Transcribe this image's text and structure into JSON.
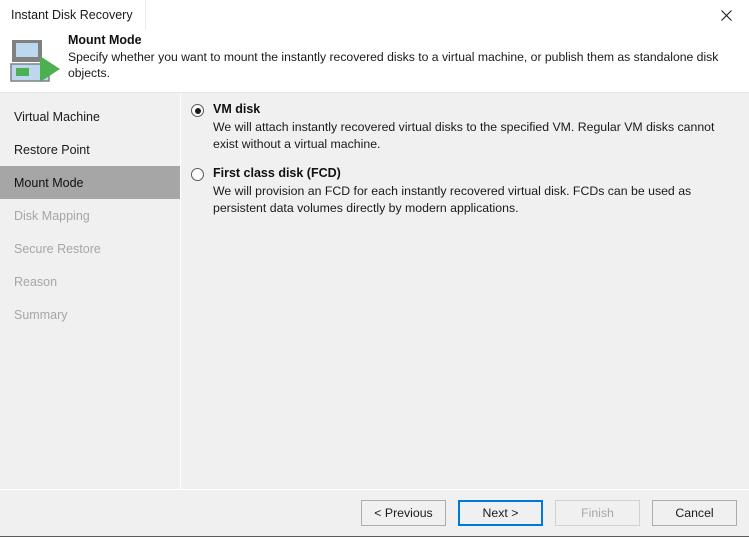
{
  "window": {
    "title": "Instant Disk Recovery",
    "close_icon": "close-icon"
  },
  "header": {
    "icon": "vm-instant-recovery-icon",
    "title": "Mount Mode",
    "description": "Specify whether you want to mount the instantly recovered disks to a virtual machine, or publish them as standalone disk objects."
  },
  "sidebar": {
    "items": [
      {
        "label": "Virtual Machine",
        "state": "done"
      },
      {
        "label": "Restore Point",
        "state": "done"
      },
      {
        "label": "Mount Mode",
        "state": "active"
      },
      {
        "label": "Disk Mapping",
        "state": "upcoming"
      },
      {
        "label": "Secure Restore",
        "state": "upcoming"
      },
      {
        "label": "Reason",
        "state": "upcoming"
      },
      {
        "label": "Summary",
        "state": "upcoming"
      }
    ]
  },
  "content": {
    "options": [
      {
        "label": "VM disk",
        "description": "We will attach instantly recovered virtual disks to the specified VM. Regular VM disks cannot exist without a virtual machine.",
        "selected": true
      },
      {
        "label": "First class disk (FCD)",
        "description": "We will provision an FCD for each instantly recovered virtual disk. FCDs can be used as persistent data volumes directly by modern applications.",
        "selected": false
      }
    ]
  },
  "footer": {
    "buttons": [
      {
        "label": "< Previous",
        "state": "normal"
      },
      {
        "label": "Next >",
        "state": "focused"
      },
      {
        "label": "Finish",
        "state": "disabled"
      },
      {
        "label": "Cancel",
        "state": "normal"
      }
    ]
  },
  "colors": {
    "accent": "#0078d7",
    "selection": "#a6a6a6",
    "icon_green": "#4caf50",
    "window_bg": "#f0f0f0"
  }
}
